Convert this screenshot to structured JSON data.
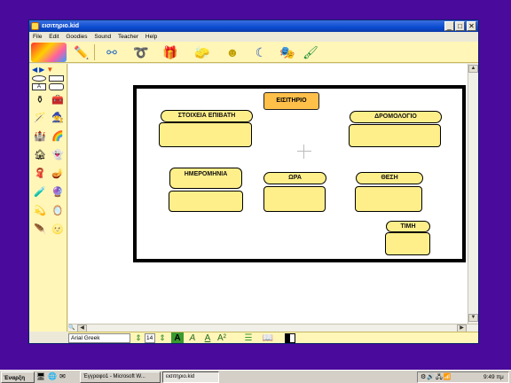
{
  "window": {
    "title": "εισιτηριο.kid",
    "minimize": "_",
    "maximize": "□",
    "close": "✕"
  },
  "menu": [
    "File",
    "Edit",
    "Goodies",
    "Sound",
    "Teacher",
    "Help"
  ],
  "toolbar_icons": [
    "pencil-icon",
    "network-icon",
    "link-icon",
    "toy-box-icon",
    "eraser-icon",
    "smiley-sun-icon",
    "moon-sound-icon",
    "masks-icon",
    "paintbrush-icon"
  ],
  "canvas": {
    "title_label": "ΕΙΣΙΤΗΡΙΟ",
    "fields": [
      {
        "key": "passenger",
        "label": "ΣΤΟΙΧΕΙΑ ΕΠΙΒΑΤΗ"
      },
      {
        "key": "route",
        "label": "ΔΡΟΜΟΛΟΓΙΟ"
      },
      {
        "key": "date",
        "label": "ΗΜΕΡΟΜΗΝΙΑ"
      },
      {
        "key": "time",
        "label": "ΩΡΑ"
      },
      {
        "key": "seat",
        "label": "ΘΕΣΗ"
      },
      {
        "key": "price",
        "label": "ΤΙΜΗ"
      }
    ]
  },
  "format": {
    "font_name": "Arial Greek",
    "font_size": "14",
    "text_sample": "A",
    "superscript_sample": "A²"
  },
  "taskbar": {
    "start_label": "Έναρξη",
    "buttons": [
      {
        "label": "Έγγραφο1 - Microsoft W...",
        "active": false
      },
      {
        "label": "εισιτηριο.kid",
        "active": true
      }
    ],
    "clock": "9:49 πμ"
  },
  "colors": {
    "desktop": "#4a0a9c",
    "toolbar": "#fff6b8",
    "field_fill": "#ffef8a",
    "title_fill": "#ffc04a"
  }
}
